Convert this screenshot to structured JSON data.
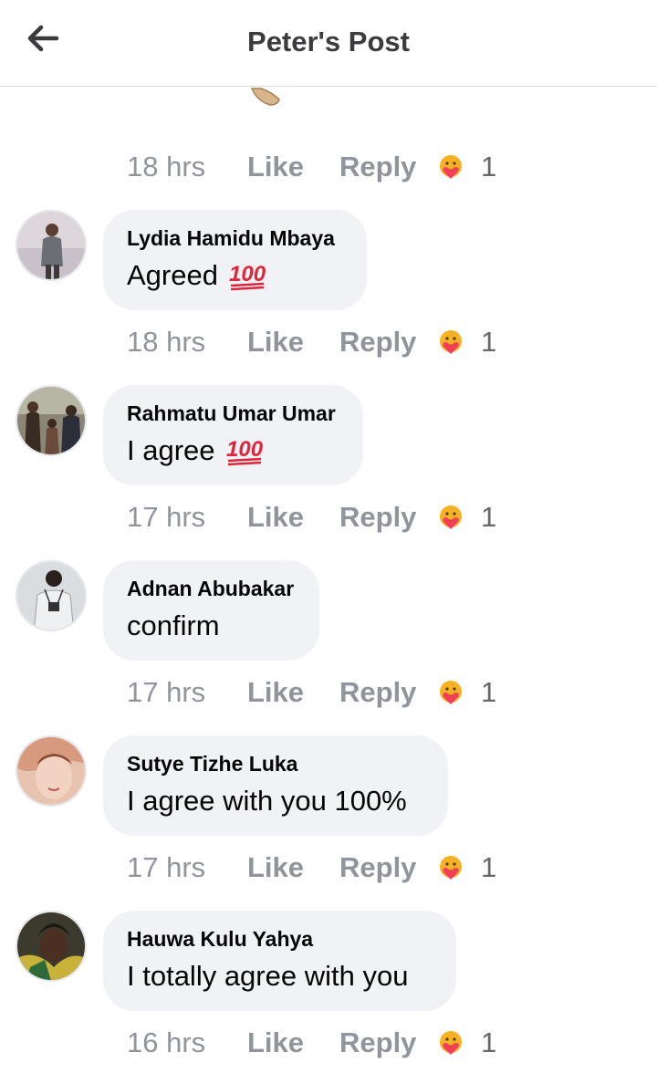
{
  "header": {
    "title": "Peter's Post",
    "back_icon": "arrow-left-icon"
  },
  "top_meta": {
    "time": "18 hrs",
    "like": "Like",
    "reply": "Reply",
    "reaction_count": "1",
    "reaction_icon": "care-reaction-icon"
  },
  "comments": [
    {
      "name": "Lydia Hamidu Mbaya",
      "text": "Agreed",
      "emoji": "hundred-points-icon",
      "time": "18 hrs",
      "like": "Like",
      "reply": "Reply",
      "reaction_count": "1"
    },
    {
      "name": "Rahmatu Umar Umar",
      "text": "I agree",
      "emoji": "hundred-points-icon",
      "time": "17 hrs",
      "like": "Like",
      "reply": "Reply",
      "reaction_count": "1"
    },
    {
      "name": "Adnan Abubakar",
      "text": "confirm",
      "time": "17 hrs",
      "like": "Like",
      "reply": "Reply",
      "reaction_count": "1"
    },
    {
      "name": "Sutye Tizhe Luka",
      "text": "I agree with you 100%",
      "time": "17 hrs",
      "like": "Like",
      "reply": "Reply",
      "reaction_count": "1"
    },
    {
      "name": "Hauwa Kulu Yahya",
      "text": "I totally agree with you",
      "time": "16 hrs",
      "like": "Like",
      "reply": "Reply",
      "reaction_count": "1"
    }
  ],
  "colors": {
    "bubble": "#f0f2f5",
    "meta_text": "#90949c",
    "reaction_face": "#f7b125",
    "heart": "#f33e58"
  }
}
